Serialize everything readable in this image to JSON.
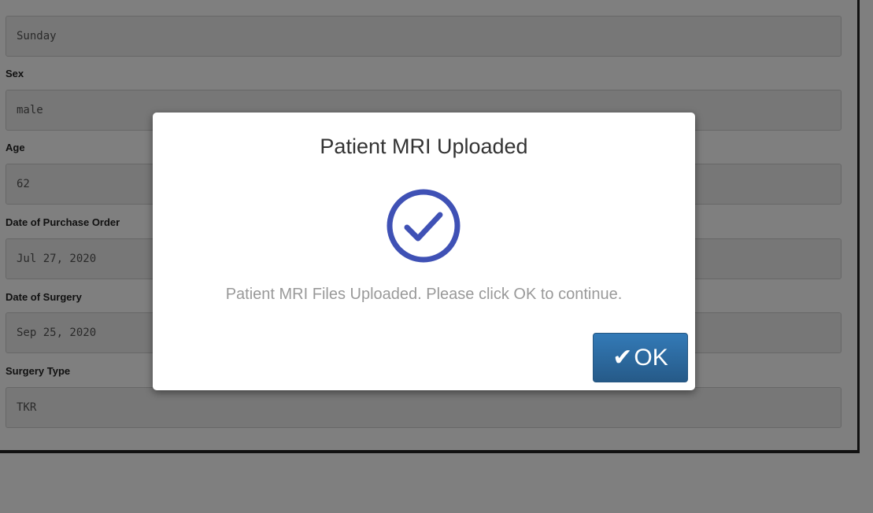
{
  "form": {
    "fields": [
      {
        "label": "",
        "value": "Sunday"
      },
      {
        "label": "Sex",
        "value": "male"
      },
      {
        "label": "Age",
        "value": "62"
      },
      {
        "label": "Date of Purchase Order",
        "value": "Jul 27, 2020"
      },
      {
        "label": "Date of Surgery",
        "value": "Sep 25, 2020"
      },
      {
        "label": "Surgery Type",
        "value": "TKR"
      }
    ]
  },
  "modal": {
    "title": "Patient MRI Uploaded",
    "icon": "check-circle-icon",
    "icon_color": "#3f51b5",
    "message": "Patient MRI Files Uploaded. Please click OK to continue.",
    "ok_icon": "✔",
    "ok_label": "OK",
    "ok_color": "#2e6da4"
  },
  "colors": {
    "overlay": "rgba(0,0,0,0.5)"
  }
}
